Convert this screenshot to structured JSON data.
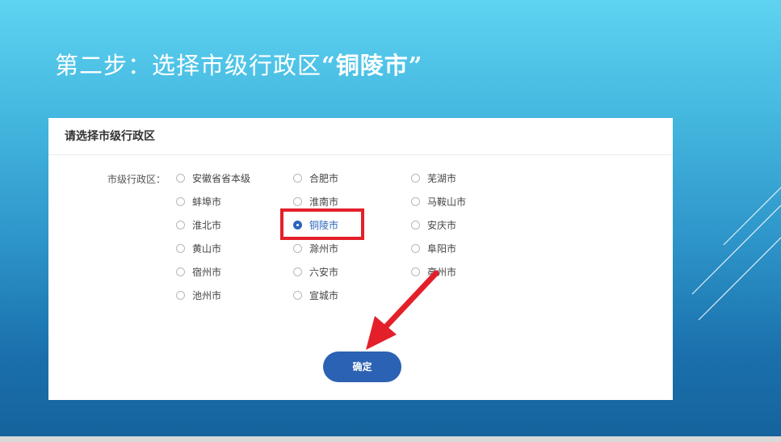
{
  "slide": {
    "title_prefix": "第二步：选择市级行政区",
    "title_quoted": "“铜陵市”"
  },
  "panel": {
    "header": "请选择市级行政区",
    "field_label": "市级行政区：",
    "options": [
      {
        "label": "安徽省省本级",
        "checked": false
      },
      {
        "label": "合肥市",
        "checked": false
      },
      {
        "label": "芜湖市",
        "checked": false
      },
      {
        "label": "蚌埠市",
        "checked": false
      },
      {
        "label": "淮南市",
        "checked": false
      },
      {
        "label": "马鞍山市",
        "checked": false
      },
      {
        "label": "淮北市",
        "checked": false
      },
      {
        "label": "铜陵市",
        "checked": true
      },
      {
        "label": "安庆市",
        "checked": false
      },
      {
        "label": "黄山市",
        "checked": false
      },
      {
        "label": "滁州市",
        "checked": false
      },
      {
        "label": "阜阳市",
        "checked": false
      },
      {
        "label": "宿州市",
        "checked": false
      },
      {
        "label": "六安市",
        "checked": false
      },
      {
        "label": "亳州市",
        "checked": false
      },
      {
        "label": "池州市",
        "checked": false
      },
      {
        "label": "宣城市",
        "checked": false
      }
    ],
    "confirm_label": "确定"
  },
  "colors": {
    "accent": "#2b62b3",
    "highlight": "#e3202a",
    "background_top": "#5fd3f1",
    "background_bottom": "#15629c"
  }
}
